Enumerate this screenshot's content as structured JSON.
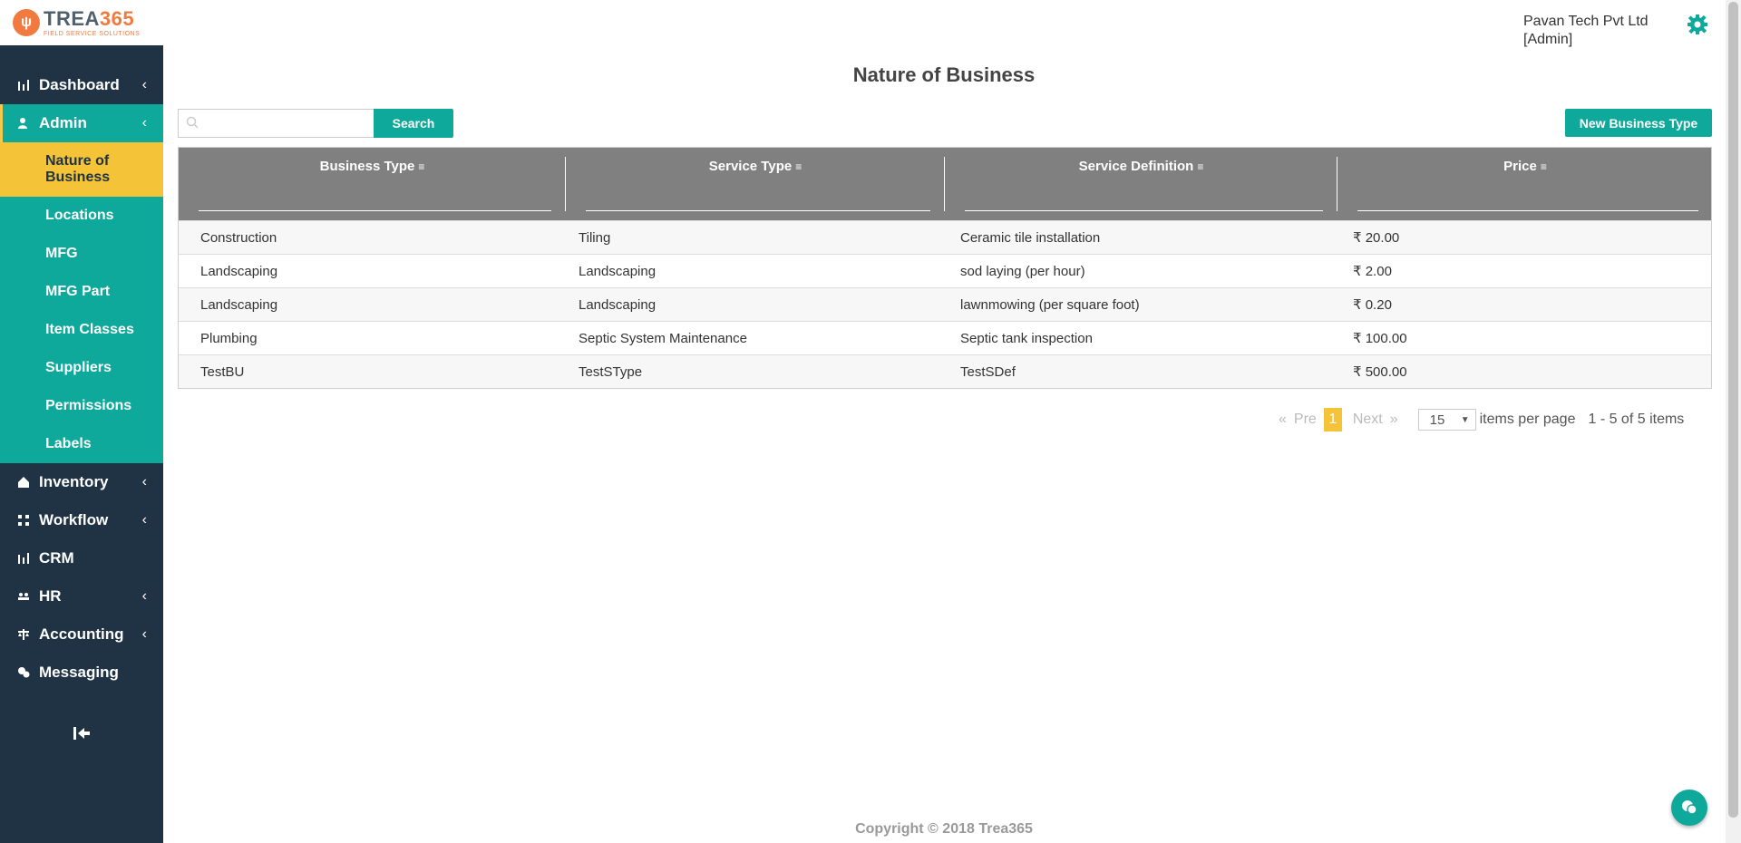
{
  "brand": {
    "name_part1": "TREA",
    "name_part2": "365",
    "tagline": "FIELD SERVICE SOLUTIONS"
  },
  "sidebar": {
    "items": [
      {
        "label": "Dashboard",
        "icon": "bar-chart-icon",
        "has_chevron": true
      },
      {
        "label": "Admin",
        "icon": "user-icon",
        "has_chevron": true,
        "active": true
      },
      {
        "label": "Inventory",
        "icon": "home-icon",
        "has_chevron": true
      },
      {
        "label": "Workflow",
        "icon": "workflow-icon",
        "has_chevron": true
      },
      {
        "label": "CRM",
        "icon": "bar-chart-icon",
        "has_chevron": false
      },
      {
        "label": "HR",
        "icon": "people-icon",
        "has_chevron": true
      },
      {
        "label": "Accounting",
        "icon": "scale-icon",
        "has_chevron": true
      },
      {
        "label": "Messaging",
        "icon": "chat-icon",
        "has_chevron": false
      }
    ],
    "admin_subitems": [
      "Nature of Business",
      "Locations",
      "MFG",
      "MFG Part",
      "Item Classes",
      "Suppliers",
      "Permissions",
      "Labels"
    ],
    "selected_subitem": "Nature of Business",
    "chevron": "‹",
    "collapse_icon": "collapse-sidebar-icon"
  },
  "header": {
    "company": "Pavan Tech Pvt Ltd",
    "role": "[Admin]",
    "settings_icon": "gear-icon"
  },
  "page": {
    "title": "Nature of Business"
  },
  "search": {
    "placeholder": "",
    "button_label": "Search",
    "icon": "search-icon"
  },
  "new_button_label": "New Business Type",
  "grid": {
    "columns": [
      "Business Type",
      "Service Type",
      "Service Definition",
      "Price"
    ],
    "rows": [
      [
        "Construction",
        "Tiling",
        "Ceramic tile installation",
        "₹ 20.00"
      ],
      [
        "Landscaping",
        "Landscaping",
        "sod laying (per hour)",
        "₹ 2.00"
      ],
      [
        "Landscaping",
        "Landscaping",
        "lawnmowing (per square foot)",
        "₹ 0.20"
      ],
      [
        "Plumbing",
        "Septic System Maintenance",
        "Septic tank inspection",
        "₹ 100.00"
      ],
      [
        "TestBU",
        "TestSType",
        "TestSDef",
        "₹ 500.00"
      ]
    ]
  },
  "pager": {
    "first_label": "«",
    "prev_label": "Pre",
    "current_page": "1",
    "next_label": "Next",
    "last_label": "»",
    "page_size": "15",
    "items_per_page_label": "items per page",
    "info": "1 - 5 of 5 items"
  },
  "footer": {
    "copyright": "Copyright © 2018 Trea365"
  },
  "colors": {
    "sidebar_bg": "#1f3344",
    "accent": "#0fa99c",
    "highlight": "#f5c337",
    "header_grid": "#808080"
  }
}
